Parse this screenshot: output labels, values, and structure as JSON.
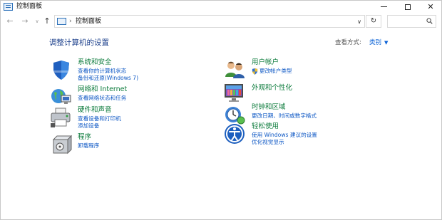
{
  "window": {
    "title": "控制面板",
    "controls": {
      "minimize": "—",
      "maximize": "☐",
      "close": "✕"
    }
  },
  "nav": {
    "back": "←",
    "forward": "→",
    "recent": "∨",
    "up": "↑",
    "address_separator": "›",
    "address": "控制面板",
    "address_dropdown": "∨",
    "refresh": "↻",
    "search_placeholder": ""
  },
  "main": {
    "heading": "调整计算机的设置",
    "view_by_label": "查看方式:",
    "view_by_value": "类别",
    "view_by_caret": "▼"
  },
  "categories": {
    "system": {
      "icon": "shield-icon",
      "title": "系统和安全",
      "links": [
        "查看你的计算机状态",
        "备份和还原(Windows 7)"
      ]
    },
    "network": {
      "icon": "globe-network-icon",
      "title": "网络和 Internet",
      "links": [
        "查看网络状态和任务"
      ]
    },
    "hardware": {
      "icon": "printer-icon",
      "title": "硬件和声音",
      "links": [
        "查看设备和打印机",
        "添加设备"
      ]
    },
    "programs": {
      "icon": "programs-box-icon",
      "title": "程序",
      "links": [
        "卸载程序"
      ]
    },
    "users": {
      "icon": "users-icon",
      "title": "用户帐户",
      "links": [
        "更改帐户类型"
      ]
    },
    "appearance": {
      "icon": "display-icon",
      "title": "外观和个性化",
      "links": []
    },
    "clock": {
      "icon": "clock-globe-icon",
      "title": "时钟和区域",
      "links": [
        "更改日期、时间或数字格式"
      ]
    },
    "ease": {
      "icon": "ease-of-access-icon",
      "title": "轻松使用",
      "links": [
        "使用 Windows 建议的设置",
        "优化视觉显示"
      ]
    }
  },
  "colors": {
    "heading": "#1b3f8b",
    "category_title": "#0a7a3a",
    "link": "#0b56c4"
  }
}
